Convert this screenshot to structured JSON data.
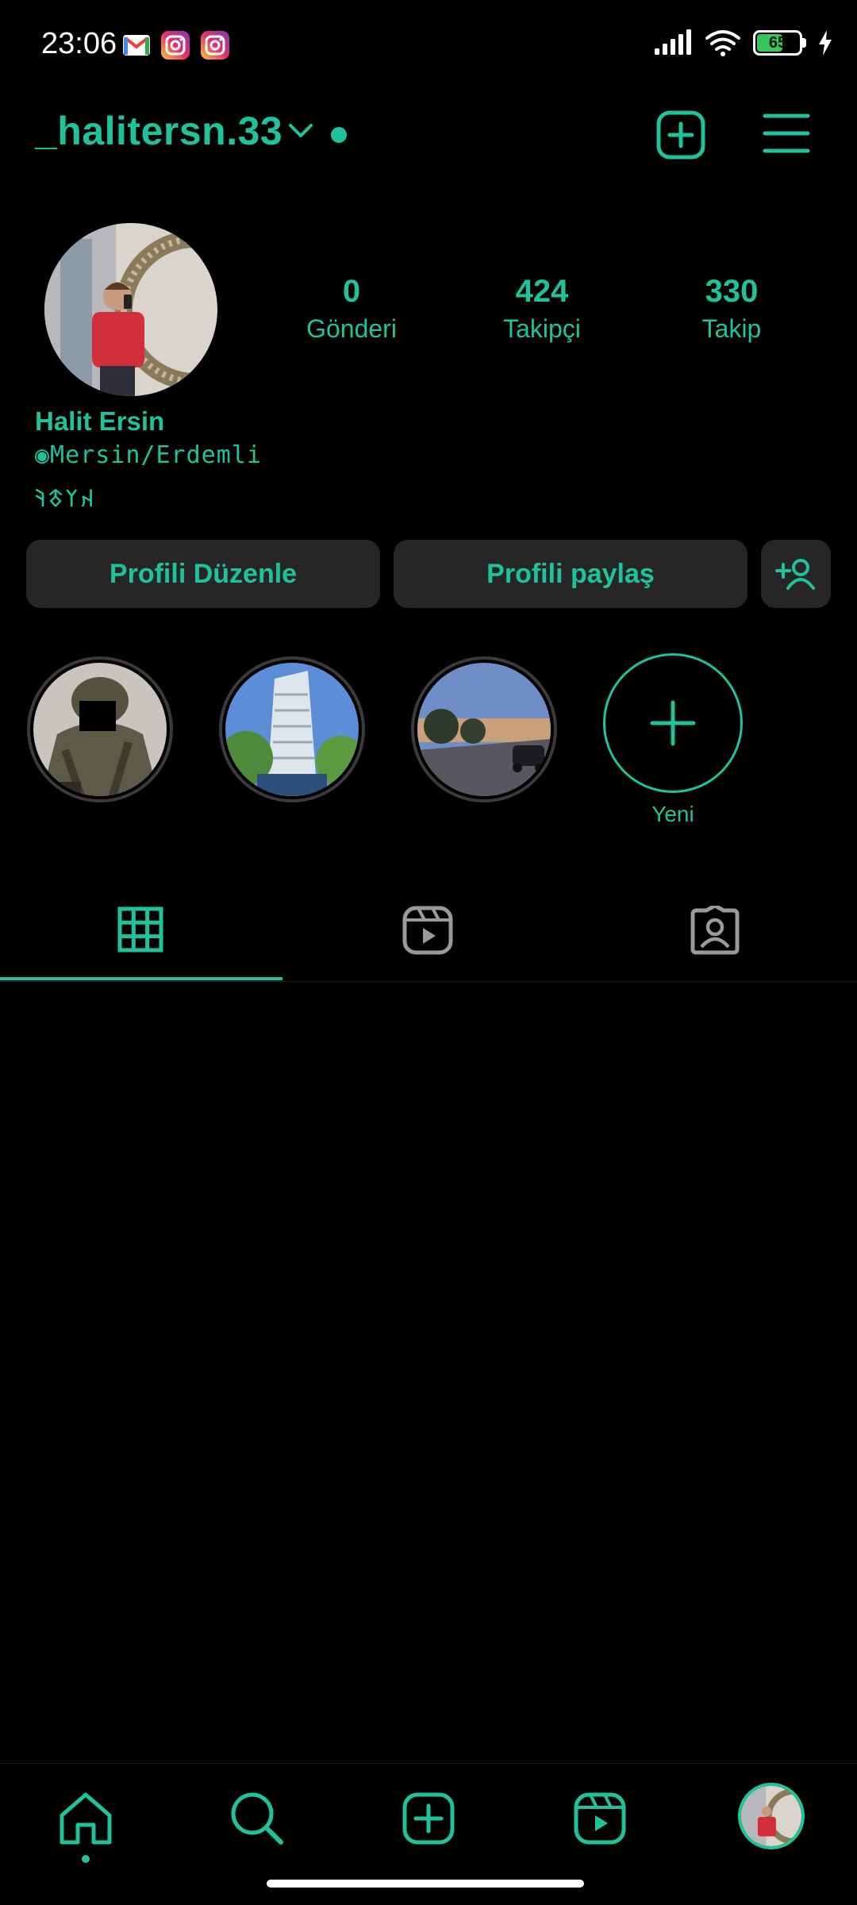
{
  "status_bar": {
    "time": "23:06",
    "notifications": [
      "gmail-icon",
      "instagram-icon",
      "instagram-icon"
    ],
    "battery": 65
  },
  "header": {
    "username": "_halitersn.33"
  },
  "profile": {
    "stats": [
      {
        "value": "0",
        "label": "Gönderi"
      },
      {
        "value": "424",
        "label": "Takipçi"
      },
      {
        "value": "330",
        "label": "Takip"
      }
    ],
    "full_name": "Halit Ersin",
    "bio": [
      "◉Mersin/Erdemli",
      "𐰴𐰠𐱃𐰚"
    ]
  },
  "buttons": {
    "edit": "Profili Düzenle",
    "share": "Profili paylaş"
  },
  "highlights": {
    "new_label": "Yeni"
  },
  "colors": {
    "accent": "#1fc29a",
    "background": "#000000",
    "button_bg": "#262626"
  }
}
